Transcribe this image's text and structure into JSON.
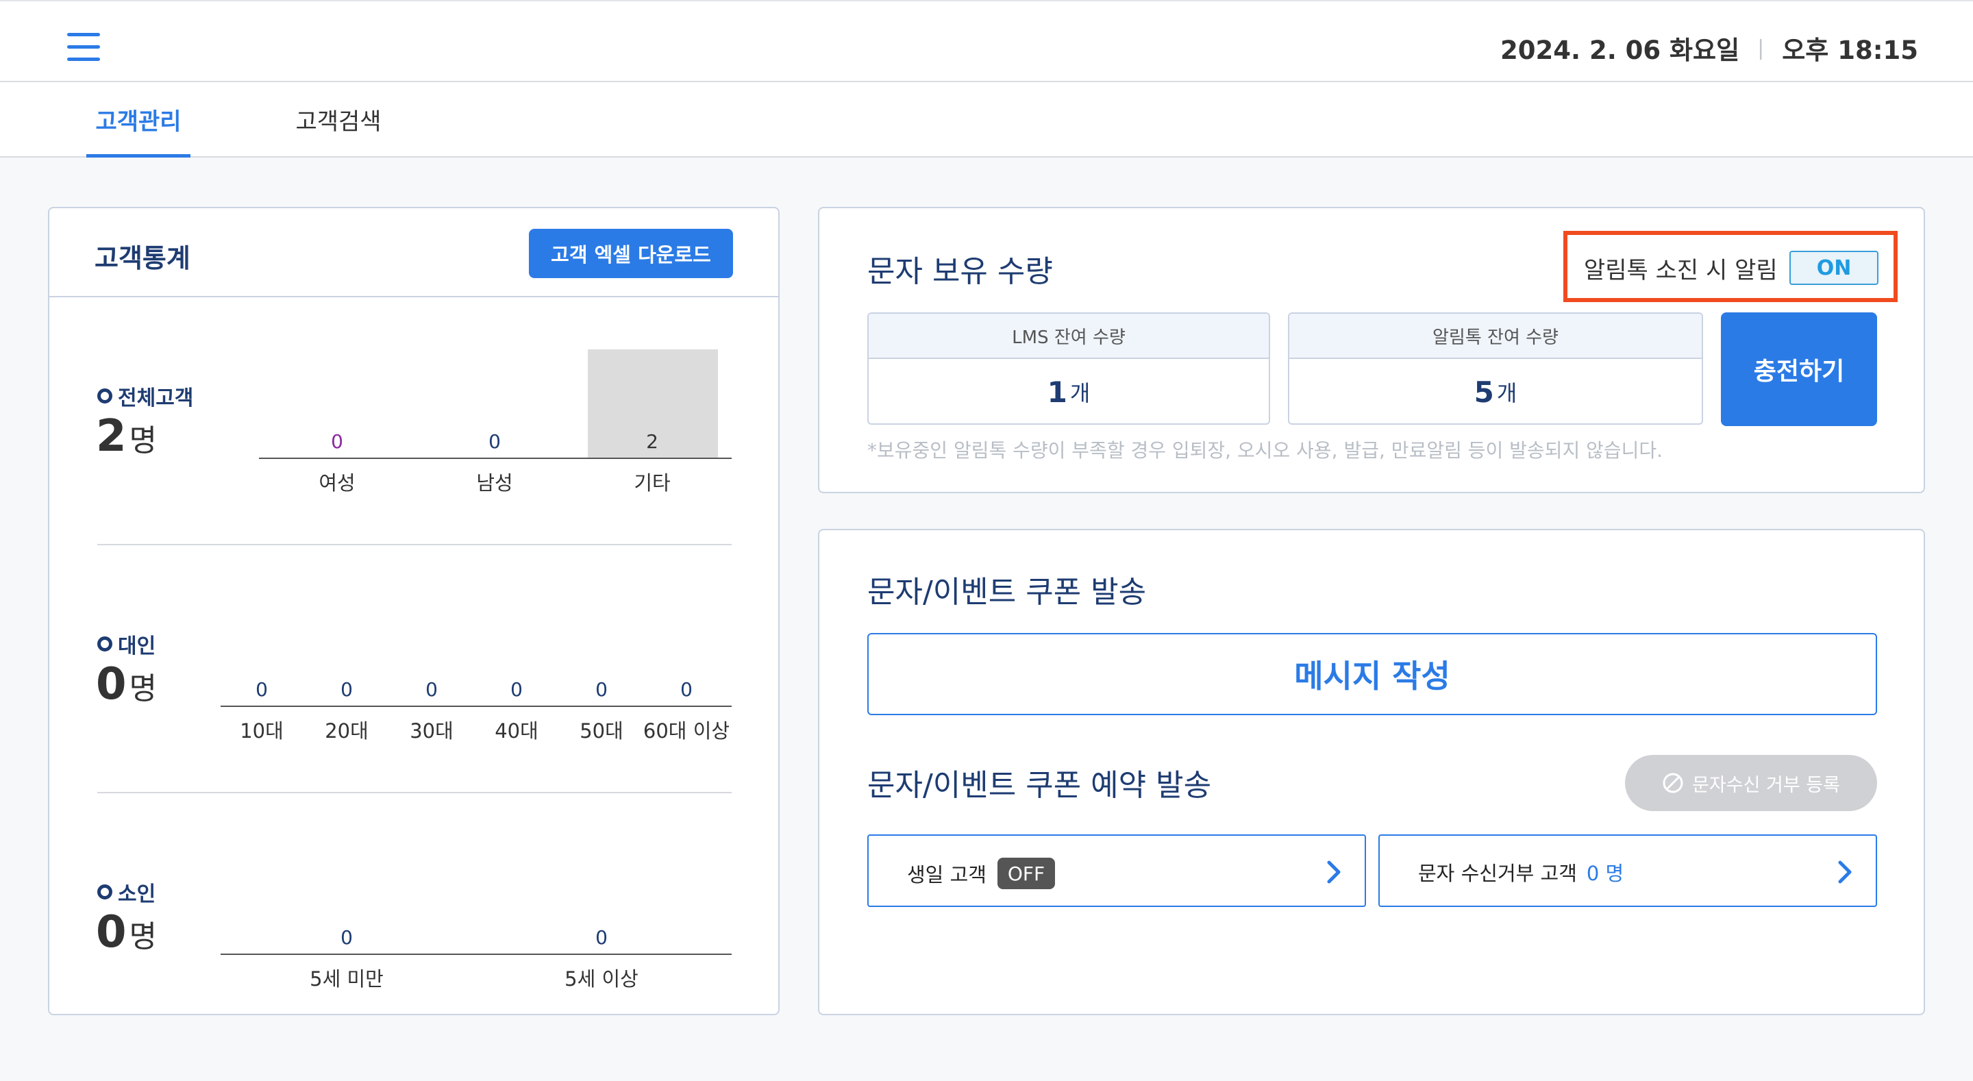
{
  "header": {
    "menu_icon": "hamburger-menu-icon",
    "date": "2024. 2. 06 화요일",
    "time": "오후 18:15"
  },
  "tabs": [
    {
      "label": "고객관리",
      "active": true
    },
    {
      "label": "고객검색",
      "active": false
    }
  ],
  "stats": {
    "title": "고객통계",
    "download_label": "고객 엑셀 다운로드",
    "total": {
      "label": "전체고객",
      "count": "2",
      "unit": "명",
      "categories": [
        "여성",
        "남성",
        "기타"
      ],
      "values": [
        0,
        0,
        2
      ]
    },
    "adult": {
      "label": "대인",
      "count": "0",
      "unit": "명",
      "categories": [
        "10대",
        "20대",
        "30대",
        "40대",
        "50대",
        "60대 이상"
      ],
      "values": [
        0,
        0,
        0,
        0,
        0,
        0
      ]
    },
    "child": {
      "label": "소인",
      "count": "0",
      "unit": "명",
      "categories": [
        "5세 미만",
        "5세 이상"
      ],
      "values": [
        0,
        0
      ]
    }
  },
  "sms": {
    "title": "문자 보유 수량",
    "alert_label": "알림톡 소진 시 알림",
    "alert_toggle": "ON",
    "lms_label": "LMS 잔여 수량",
    "lms_value": "1",
    "alimtalk_label": "알림톡 잔여 수량",
    "alimtalk_value": "5",
    "unit": "개",
    "charge_label": "충전하기",
    "notice": "*보유중인 알림톡 수량이 부족할 경우 입퇴장, 오시오 사용, 발급, 만료알림 등이 발송되지 않습니다."
  },
  "coupon": {
    "send_title": "문자/이벤트 쿠폰 발송",
    "write_label": "메시지 작성",
    "reserve_title": "문자/이벤트 쿠폰 예약 발송",
    "reject_register_label": "문자수신 거부 등록",
    "birthday_label": "생일 고객",
    "birthday_toggle": "OFF",
    "reject_customer_label": "문자 수신거부 고객",
    "reject_count": "0 명"
  },
  "colors": {
    "accent": "#2b7be6",
    "navy": "#1e3c72",
    "highlight": "#f04b20",
    "female_value": "#8b2a9e"
  }
}
